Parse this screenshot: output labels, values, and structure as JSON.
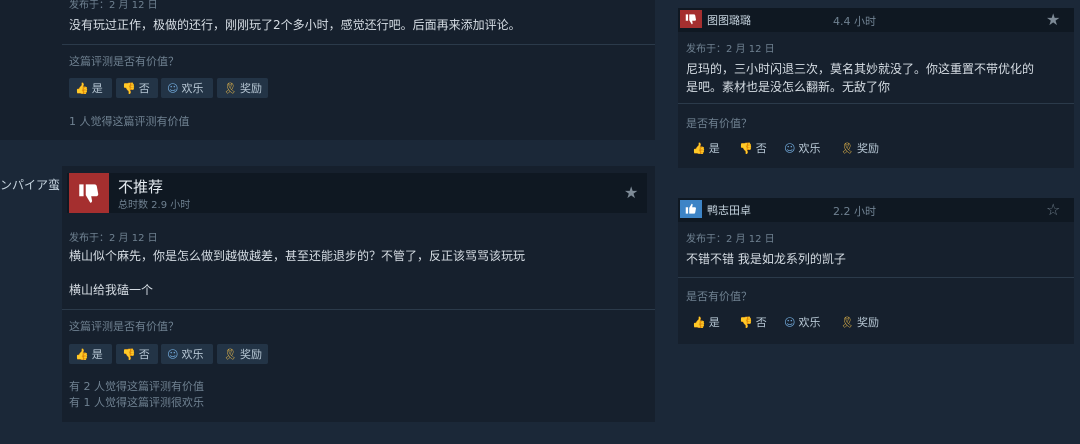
{
  "left": {
    "review1": {
      "posted": "发布于：2 月 12 日",
      "body": "没有玩过正作，极做的还行，刚刚玩了2个多小时，感觉还行吧。后面再来添加评论。",
      "helpful_question": "这篇评测是否有价值？",
      "buttons": {
        "yes": "是",
        "no": "否",
        "funny": "欢乐",
        "award": "奖励"
      },
      "stats": [
        "1 人觉得这篇评测有价值"
      ]
    },
    "review2": {
      "author_fragment": "ンパイア蛮",
      "verdict": "不推荐",
      "hours": "总时数 2.9 小时",
      "posted": "发布于：2 月 12 日",
      "body_lines": [
        "横山似个麻先，你是怎么做到越做越差，甚至还能退步的？不管了，反正该骂骂该玩玩",
        "横山给我磕一个"
      ],
      "helpful_question": "这篇评测是否有价值？",
      "buttons": {
        "yes": "是",
        "no": "否",
        "funny": "欢乐",
        "award": "奖励"
      },
      "stats": [
        "有 2 人觉得这篇评测有价值",
        "有 1 人觉得这篇评测很欢乐"
      ]
    }
  },
  "right": {
    "review1": {
      "author": "图图璐璐",
      "hours": "4.4 小时",
      "posted": "发布于：2 月 12 日",
      "body_lines": [
        "尼玛的，三小时闪退三次，莫名其妙就没了。你这重置不带优化的",
        "是吧。素材也是没怎么翻新。无敌了你"
      ],
      "helpful_question": "是否有价值？",
      "buttons": {
        "yes": "是",
        "no": "否",
        "funny": "欢乐",
        "award": "奖励"
      }
    },
    "review2": {
      "author": "鸭志田卓",
      "hours": "2.2 小时",
      "posted": "发布于：2 月 12 日",
      "body": "不错不错 我是如龙系列的凯子",
      "helpful_question": "是否有价值？",
      "buttons": {
        "yes": "是",
        "no": "否",
        "funny": "欢乐",
        "award": "奖励"
      }
    }
  },
  "colors": {
    "thumb_down": "#a52f2f",
    "thumb_up": "#3d84c6",
    "award": "#e7b84a"
  },
  "icons": [
    "thumb-up-icon",
    "thumb-down-icon",
    "smile-icon",
    "award-icon",
    "star-icon"
  ]
}
